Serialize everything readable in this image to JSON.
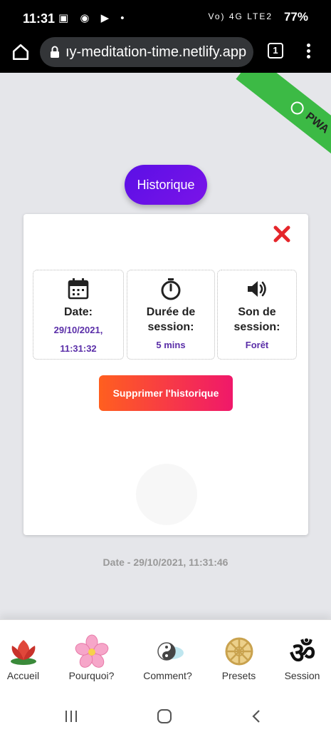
{
  "status": {
    "time": "11:31",
    "battery": "77%",
    "network": "Vo) 4G LTE2"
  },
  "browser": {
    "url": "ıy-meditation-time.netlify.app",
    "tab_count": "1"
  },
  "ribbon": {
    "label": "PWA"
  },
  "page": {
    "title_button": "Historique"
  },
  "card": {
    "date": {
      "label": "Date:",
      "value_line1": "29/10/2021,",
      "value_line2": "11:31:32"
    },
    "duration": {
      "label_line1": "Durée de",
      "label_line2": "session:",
      "value": "5 mins"
    },
    "sound": {
      "label_line1": "Son de",
      "label_line2": "session:",
      "value": "Forêt"
    },
    "delete_button": "Supprimer l'historique"
  },
  "footer_date": "Date - 29/10/2021, 11:31:46",
  "nav": [
    {
      "label": "Accueil",
      "icon": "lotus-icon"
    },
    {
      "label": "Pourquoi?",
      "icon": "flower-icon"
    },
    {
      "label": "Comment?",
      "icon": "yin-yang-icon"
    },
    {
      "label": "Presets",
      "icon": "dharma-wheel-icon"
    },
    {
      "label": "Session",
      "icon": "om-icon"
    }
  ],
  "colors": {
    "accent": "#6a12e6",
    "value_text": "#5a2ea8",
    "ribbon": "#3cba45"
  }
}
